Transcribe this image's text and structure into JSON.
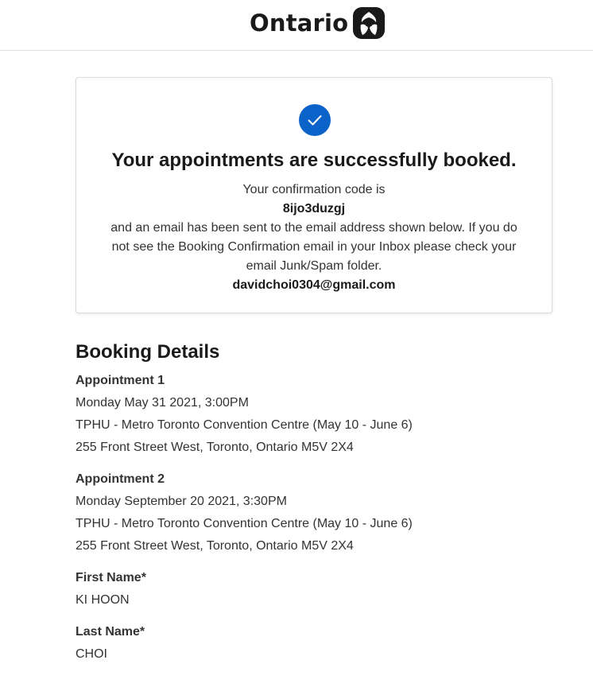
{
  "header": {
    "brand_name": "Ontario",
    "logo_icon": "ontario-trillium-icon"
  },
  "confirmation": {
    "check_icon": "checkmark-icon",
    "accent_color": "#0b62c9",
    "title": "Your appointments are successfully booked.",
    "intro": "Your confirmation code is",
    "code": "8ijo3duzgj",
    "message_line1": "and an email has been sent to the email address shown below. If you do",
    "message_line2": "not see the Booking Confirmation email in your Inbox please check your",
    "message_line3": "email Junk/Spam folder.",
    "email": "davidchoi0304@gmail.com"
  },
  "booking": {
    "title": "Booking Details",
    "appointments": [
      {
        "label": "Appointment 1",
        "datetime": "Monday May 31 2021, 3:00PM",
        "location": "TPHU - Metro Toronto Convention Centre (May 10 - June 6)",
        "address": "255 Front Street West, Toronto, Ontario M5V 2X4"
      },
      {
        "label": "Appointment 2",
        "datetime": "Monday September 20 2021, 3:30PM",
        "location": "TPHU - Metro Toronto Convention Centre (May 10 - June 6)",
        "address": "255 Front Street West, Toronto, Ontario M5V 2X4"
      }
    ],
    "first_name_label": "First Name*",
    "first_name": "KI HOON",
    "last_name_label": "Last Name*",
    "last_name": "CHOI"
  }
}
